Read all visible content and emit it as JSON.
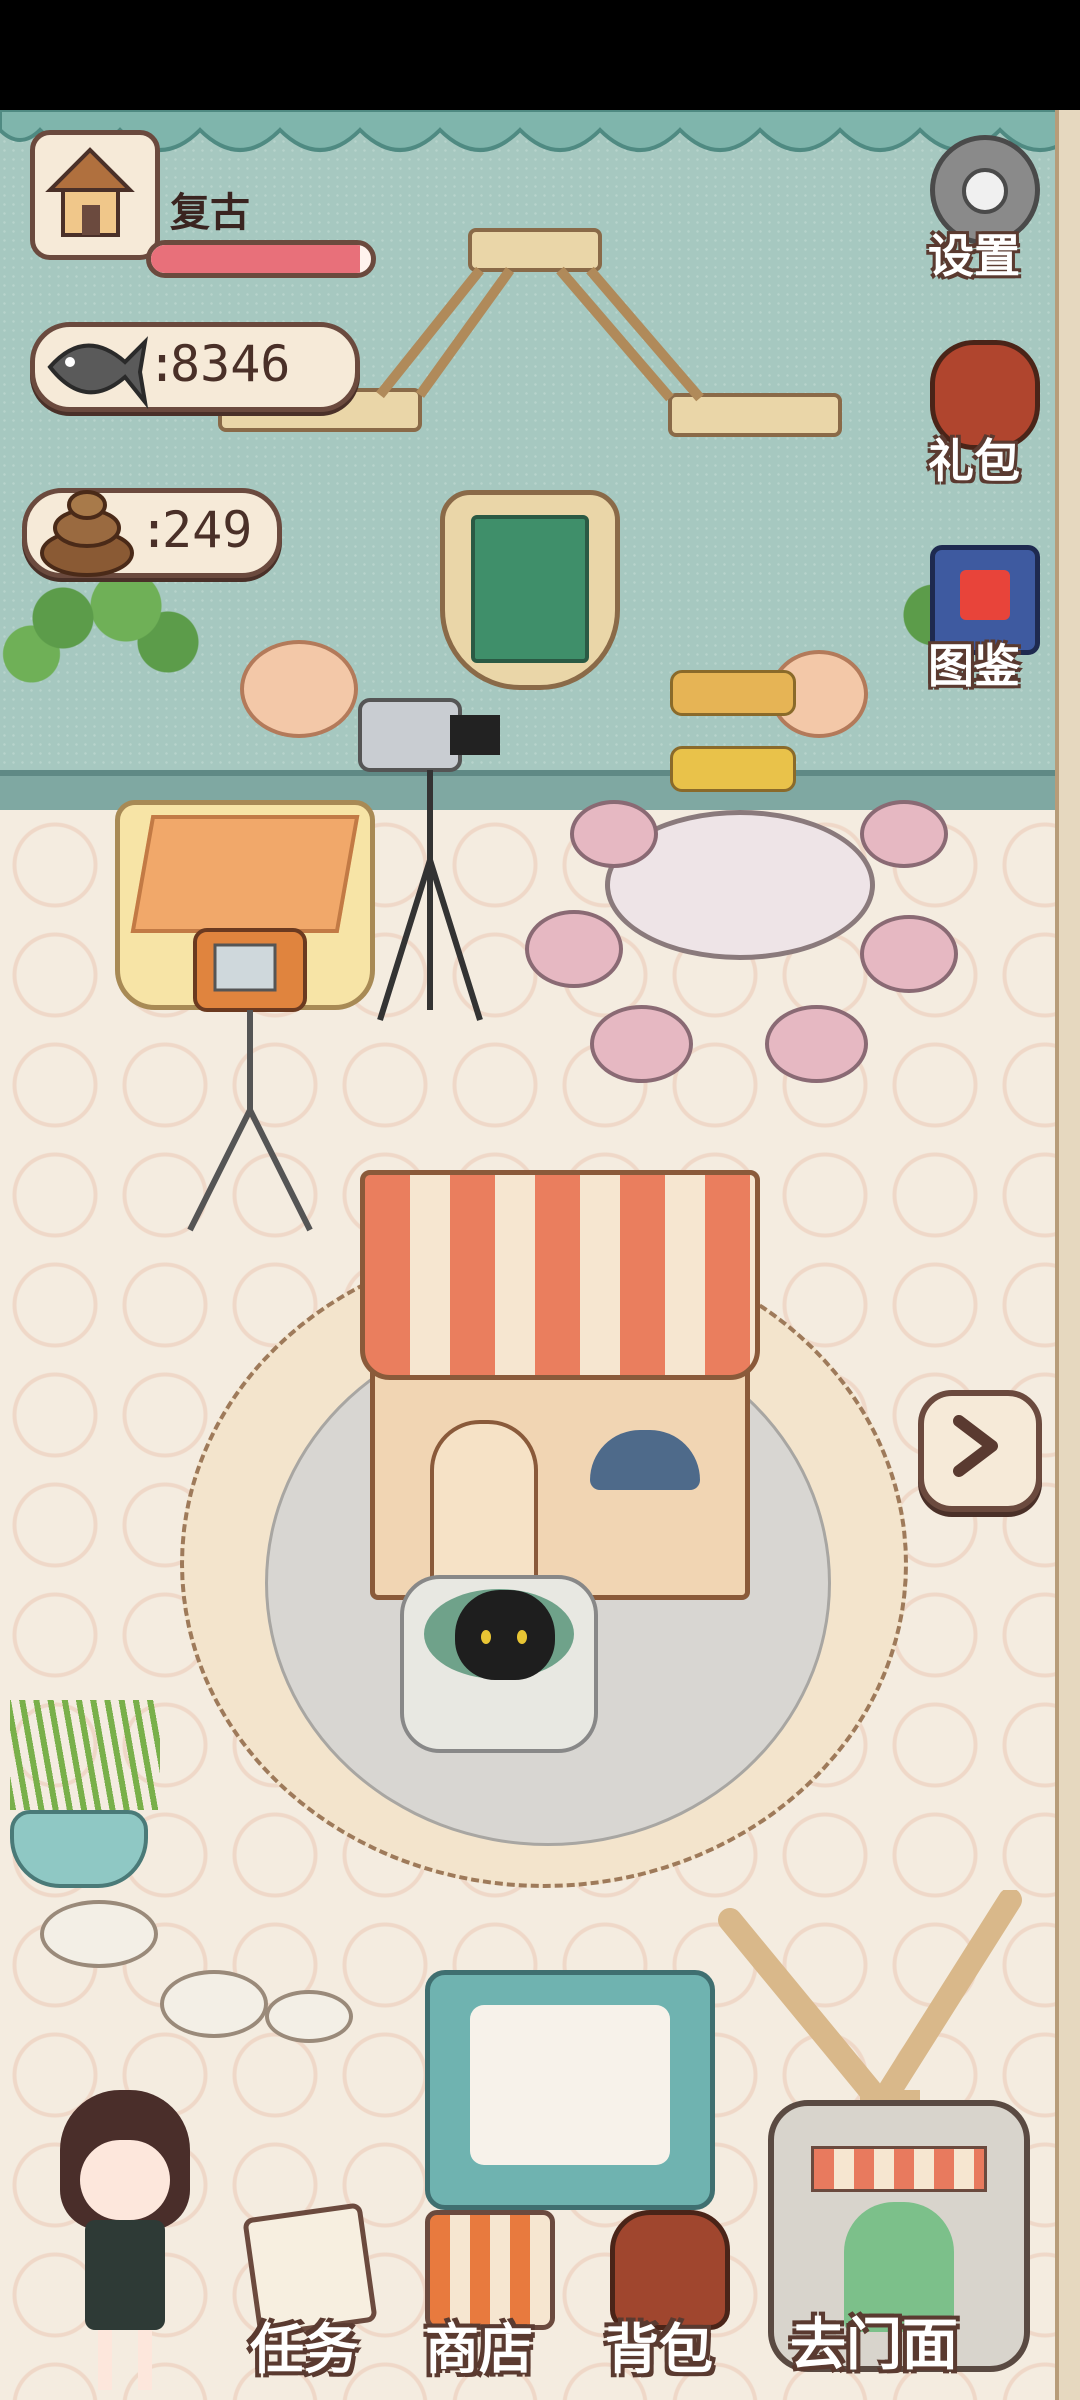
{
  "hud": {
    "room_name": "复古",
    "room_progress": 0.95,
    "fish_count": "8346",
    "poop_count": "249",
    "colon": ":"
  },
  "side_menu": {
    "settings": "设置",
    "gift_pack": "礼包",
    "catalog": "图鉴"
  },
  "bottom_menu": {
    "tasks": "任务",
    "shop": "商店",
    "backpack": "背包",
    "go_storefront": "去门面"
  },
  "colors": {
    "wall": "#a6c8c0",
    "floor": "#f4ece0",
    "progress_fill": "#e8707a",
    "outline": "#6b4a3e"
  },
  "icons": [
    "house-icon",
    "fish-icon",
    "poop-icon",
    "gear-icon",
    "gift-icon",
    "book-icon",
    "arrow-right-icon",
    "task-icon",
    "shop-icon",
    "backpack-icon",
    "storefront-icon"
  ]
}
